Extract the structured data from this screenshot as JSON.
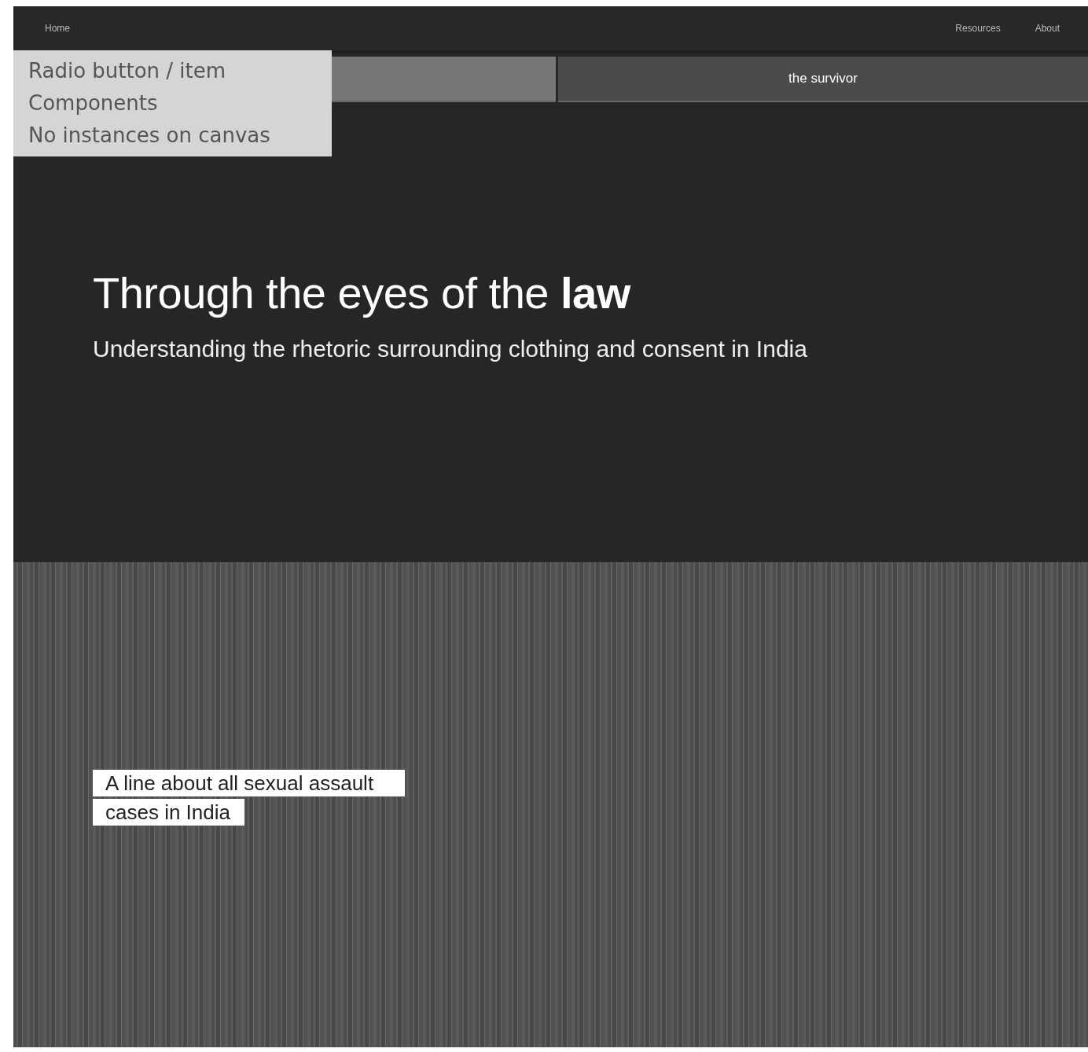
{
  "nav": {
    "brand": "Home",
    "links": [
      "Resources",
      "About"
    ]
  },
  "tabs": [
    {
      "selected": true
    },
    {
      "label": "the survivor",
      "selected": false
    }
  ],
  "tooltip": {
    "lines": [
      "Radio button / item",
      "Components",
      "No instances on canvas"
    ]
  },
  "hero": {
    "title": "Through the eyes of the **law**",
    "subtitle": "Understanding the rhetoric surrounding clothing and consent in India"
  },
  "caption": [
    "A line about all sexual assault",
    "cases in India"
  ]
}
